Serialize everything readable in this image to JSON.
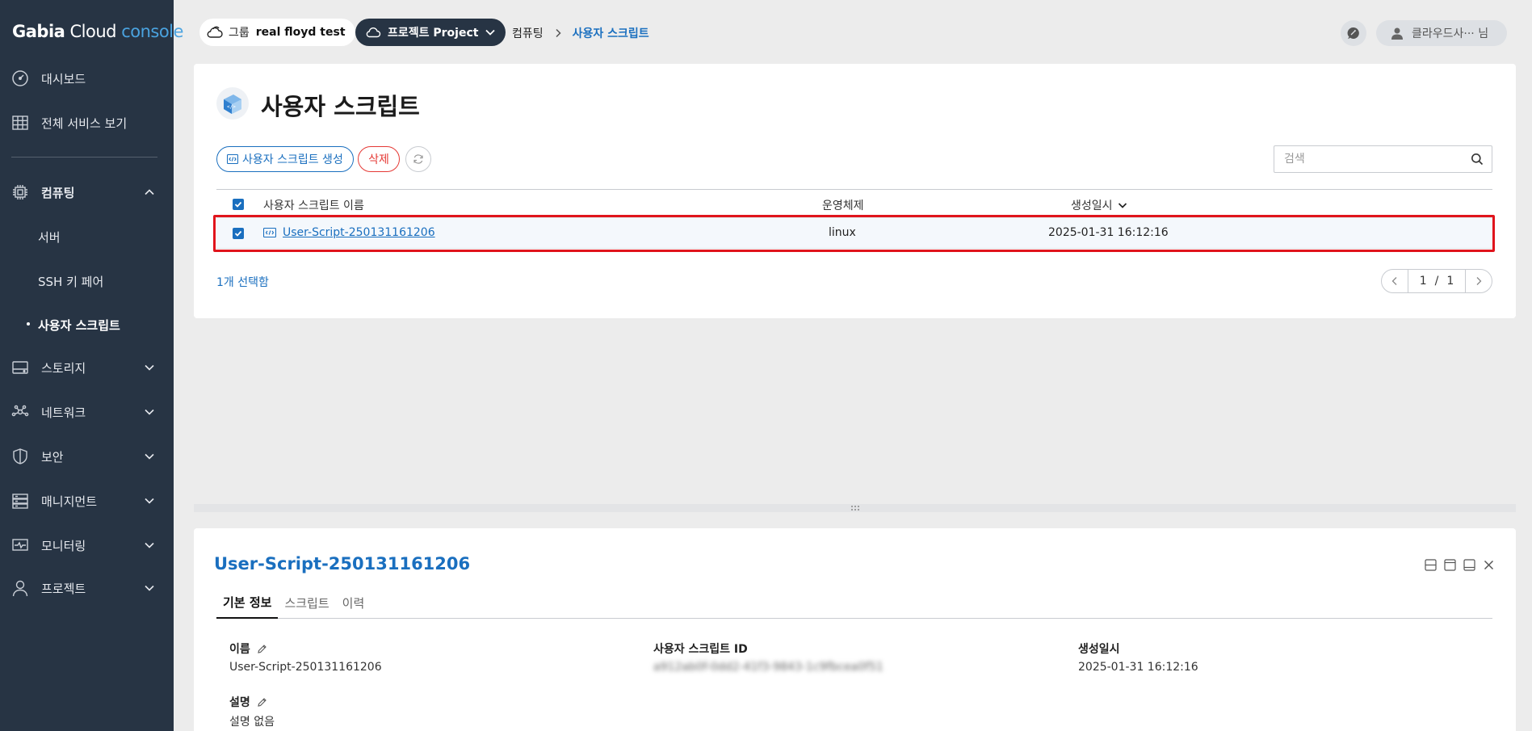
{
  "brand": {
    "word1": "Gabia",
    "word2": "Cloud",
    "word3": "console"
  },
  "sidebar": {
    "top_items": [
      {
        "label": "대시보드",
        "icon": "dashboard-gauge-icon"
      },
      {
        "label": "전체 서비스 보기",
        "icon": "grid-icon"
      }
    ],
    "compute": {
      "label": "컴퓨팅",
      "icon": "chip-icon",
      "expanded": true,
      "children": [
        "서버",
        "SSH 키 페어",
        "사용자 스크립트"
      ],
      "active_child": "사용자 스크립트"
    },
    "sections": [
      {
        "label": "스토리지",
        "icon": "storage-icon"
      },
      {
        "label": "네트워크",
        "icon": "network-icon"
      },
      {
        "label": "보안",
        "icon": "shield-icon"
      },
      {
        "label": "매니지먼트",
        "icon": "management-icon"
      },
      {
        "label": "모니터링",
        "icon": "monitoring-icon"
      },
      {
        "label": "프로젝트",
        "icon": "person-icon"
      }
    ]
  },
  "topbar": {
    "group_key": "그룹",
    "group_value": "real floyd test",
    "project_label": "프로젝트 Project",
    "breadcrumb": {
      "parent": "컴퓨팅",
      "current": "사용자 스크립트"
    },
    "user_name": "클라우드사··· 님"
  },
  "page": {
    "title": "사용자 스크립트",
    "create_button": "사용자 스크립트 생성",
    "delete_button": "삭제",
    "search_placeholder": "검색"
  },
  "table": {
    "headers": {
      "name": "사용자 스크립트 이름",
      "os": "운영체제",
      "created": "생성일시"
    },
    "rows": [
      {
        "name": "User-Script-250131161206",
        "os": "linux",
        "created": "2025-01-31 16:12:16",
        "checked": true
      }
    ],
    "selected_text": "1개 선택함",
    "pagination": {
      "current": "1",
      "sep": "/",
      "total": "1"
    }
  },
  "detail": {
    "title": "User-Script-250131161206",
    "tabs": [
      "기본 정보",
      "스크립트",
      "이력"
    ],
    "active_tab": "기본 정보",
    "fields": {
      "name_label": "이름",
      "name_value": "User-Script-250131161206",
      "id_label": "사용자 스크립트 ID",
      "id_value": "a912ab0f-0dd2-41f3-9843-1c9fbcea0f51",
      "created_label": "생성일시",
      "created_value": "2025-01-31 16:12:16",
      "desc_label": "설명",
      "desc_value": "설명 없음"
    }
  },
  "colors": {
    "sidebar_bg": "#273444",
    "accent": "#1a6fbf",
    "danger": "#e53935",
    "highlight": "#e0141c"
  }
}
